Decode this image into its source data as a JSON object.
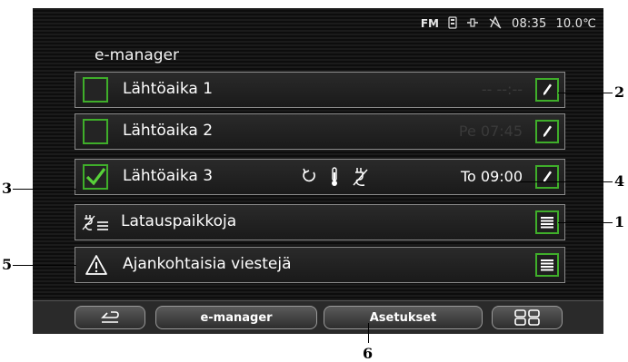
{
  "status": {
    "fm": "FM",
    "time": "08:35",
    "temperature": "10.0℃",
    "icons": [
      "phone-battery-icon",
      "plug-icon",
      "gps-icon"
    ]
  },
  "header": {
    "title": "e-manager"
  },
  "rows": [
    {
      "label": "Lähtöaika 1",
      "time": "-- --:--",
      "checked": false
    },
    {
      "label": "Lähtöaika 2",
      "time": "Pe 07:45",
      "checked": false
    },
    {
      "label": "Lähtöaika 3",
      "time": "To 09:00",
      "checked": true
    },
    {
      "label": "Latauspaikkoja"
    },
    {
      "label": "Ajankohtaisia viestejä"
    }
  ],
  "bottom": {
    "back": "back",
    "emanager": "e-manager",
    "settings": "Asetukset",
    "grid": "grid"
  },
  "callouts": {
    "c1": "1",
    "c2": "2",
    "c3": "3",
    "c4": "4",
    "c5": "5",
    "c6": "6"
  },
  "colors": {
    "accent": "#3fae2a",
    "dim_time": "#3a3a3a",
    "active_time": "#ffffff"
  }
}
